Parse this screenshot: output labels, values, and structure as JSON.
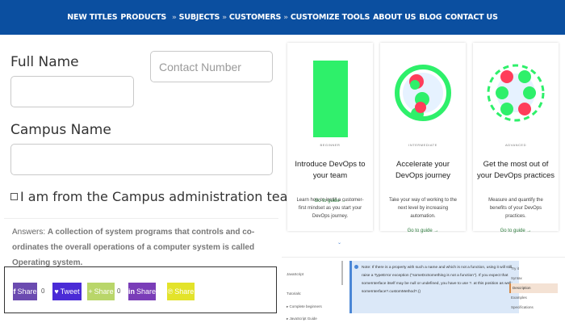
{
  "nav": {
    "new_titles": "NEW TITLES",
    "products": "PRODUCTS",
    "subjects": "SUBJECTS",
    "customers": "CUSTOMERS",
    "customize_tools": "CUSTOMIZE TOOLS",
    "about_us": "ABOUT US",
    "blog": "BLOG",
    "contact_us": "CONTACT US",
    "separator": "»"
  },
  "form": {
    "full_name_label": "Full Name",
    "full_name_value": "",
    "contact_placeholder": "Contact Number",
    "campus_name_label": "Campus Name",
    "campus_name_value": "",
    "checkbox_label": "I am from the Campus administration team"
  },
  "answers": {
    "prefix": "Answers:",
    "text": "A collection of system programs that controls and co-ordinates the overall operations of a computer system is called Operating system."
  },
  "share": {
    "facebook": "Share",
    "facebook_count": "0",
    "twitter": "Tweet",
    "generic": "Share",
    "generic_count": "0",
    "linkedin": "Share",
    "pinterest": "Share",
    "colors": {
      "facebook": "#6b4bb0",
      "twitter": "#4a2bd6",
      "generic": "#b9d66a",
      "linkedin": "#7a3db8",
      "pinterest": "#e3e32a"
    }
  },
  "cards": [
    {
      "level": "BEGINNER",
      "title": "Introduce DevOps to your team",
      "description": "Learn how to instill a customer-first mindset as you start your DevOps journey.",
      "link": "Go to guide →"
    },
    {
      "level": "INTERMEDIATE",
      "title": "Accelerate your DevOps journey",
      "description": "Take your way of working to the next level by increasing automation.",
      "link": "Go to guide →"
    },
    {
      "level": "ADVANCED",
      "title": "Get the most out of your DevOps practices",
      "description": "Measure and quantify the benefits of your DevOps practices.",
      "link": "Go to guide →"
    }
  ],
  "doc": {
    "sidebar": [
      "JavaScript",
      "Tutorials:",
      "▸ Complete beginners",
      "▸ JavaScript Guide"
    ],
    "note": "Note: If there is a property with such a name and which is not a function, using it will still raise a TypeError exception (\"someDoSomething is not a function\"). If you expect that someInterface itself may be null or undefined, you have to use ?. at this position as well: someInterface?.customMethod?.()",
    "toc": [
      "Try it",
      "Syntax",
      "Description",
      "Examples",
      "Specifications"
    ]
  }
}
